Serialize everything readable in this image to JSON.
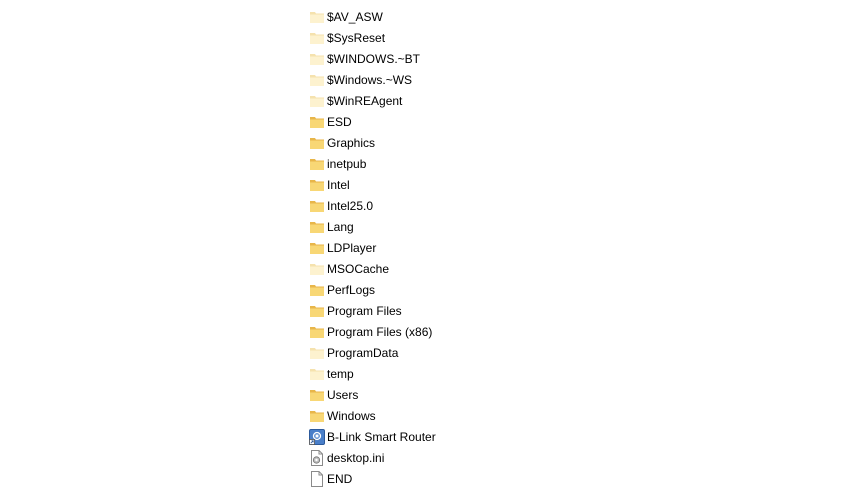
{
  "explorer": {
    "items": [
      {
        "name": "$AV_ASW",
        "icon": "hidden-folder-icon"
      },
      {
        "name": "$SysReset",
        "icon": "hidden-folder-icon"
      },
      {
        "name": "$WINDOWS.~BT",
        "icon": "hidden-folder-icon"
      },
      {
        "name": "$Windows.~WS",
        "icon": "hidden-folder-icon"
      },
      {
        "name": "$WinREAgent",
        "icon": "hidden-folder-icon"
      },
      {
        "name": "ESD",
        "icon": "folder-icon"
      },
      {
        "name": "Graphics",
        "icon": "folder-icon"
      },
      {
        "name": "inetpub",
        "icon": "folder-icon"
      },
      {
        "name": "Intel",
        "icon": "folder-icon"
      },
      {
        "name": "Intel25.0",
        "icon": "folder-icon"
      },
      {
        "name": "Lang",
        "icon": "folder-icon"
      },
      {
        "name": "LDPlayer",
        "icon": "folder-icon"
      },
      {
        "name": "MSOCache",
        "icon": "hidden-folder-icon"
      },
      {
        "name": "PerfLogs",
        "icon": "folder-icon"
      },
      {
        "name": "Program Files",
        "icon": "folder-icon"
      },
      {
        "name": "Program Files (x86)",
        "icon": "folder-icon"
      },
      {
        "name": "ProgramData",
        "icon": "hidden-folder-icon"
      },
      {
        "name": "temp",
        "icon": "hidden-folder-icon"
      },
      {
        "name": "Users",
        "icon": "folder-icon"
      },
      {
        "name": "Windows",
        "icon": "folder-icon"
      },
      {
        "name": "B-Link Smart Router",
        "icon": "app-shortcut-icon"
      },
      {
        "name": "desktop.ini",
        "icon": "settings-file-icon"
      },
      {
        "name": "END",
        "icon": "blank-file-icon"
      }
    ]
  },
  "colors": {
    "folder_fill": "#F8D775",
    "folder_back": "#E8B64A",
    "hidden_folder_fill": "#FDF2CF",
    "hidden_folder_back": "#F5E2AE"
  }
}
